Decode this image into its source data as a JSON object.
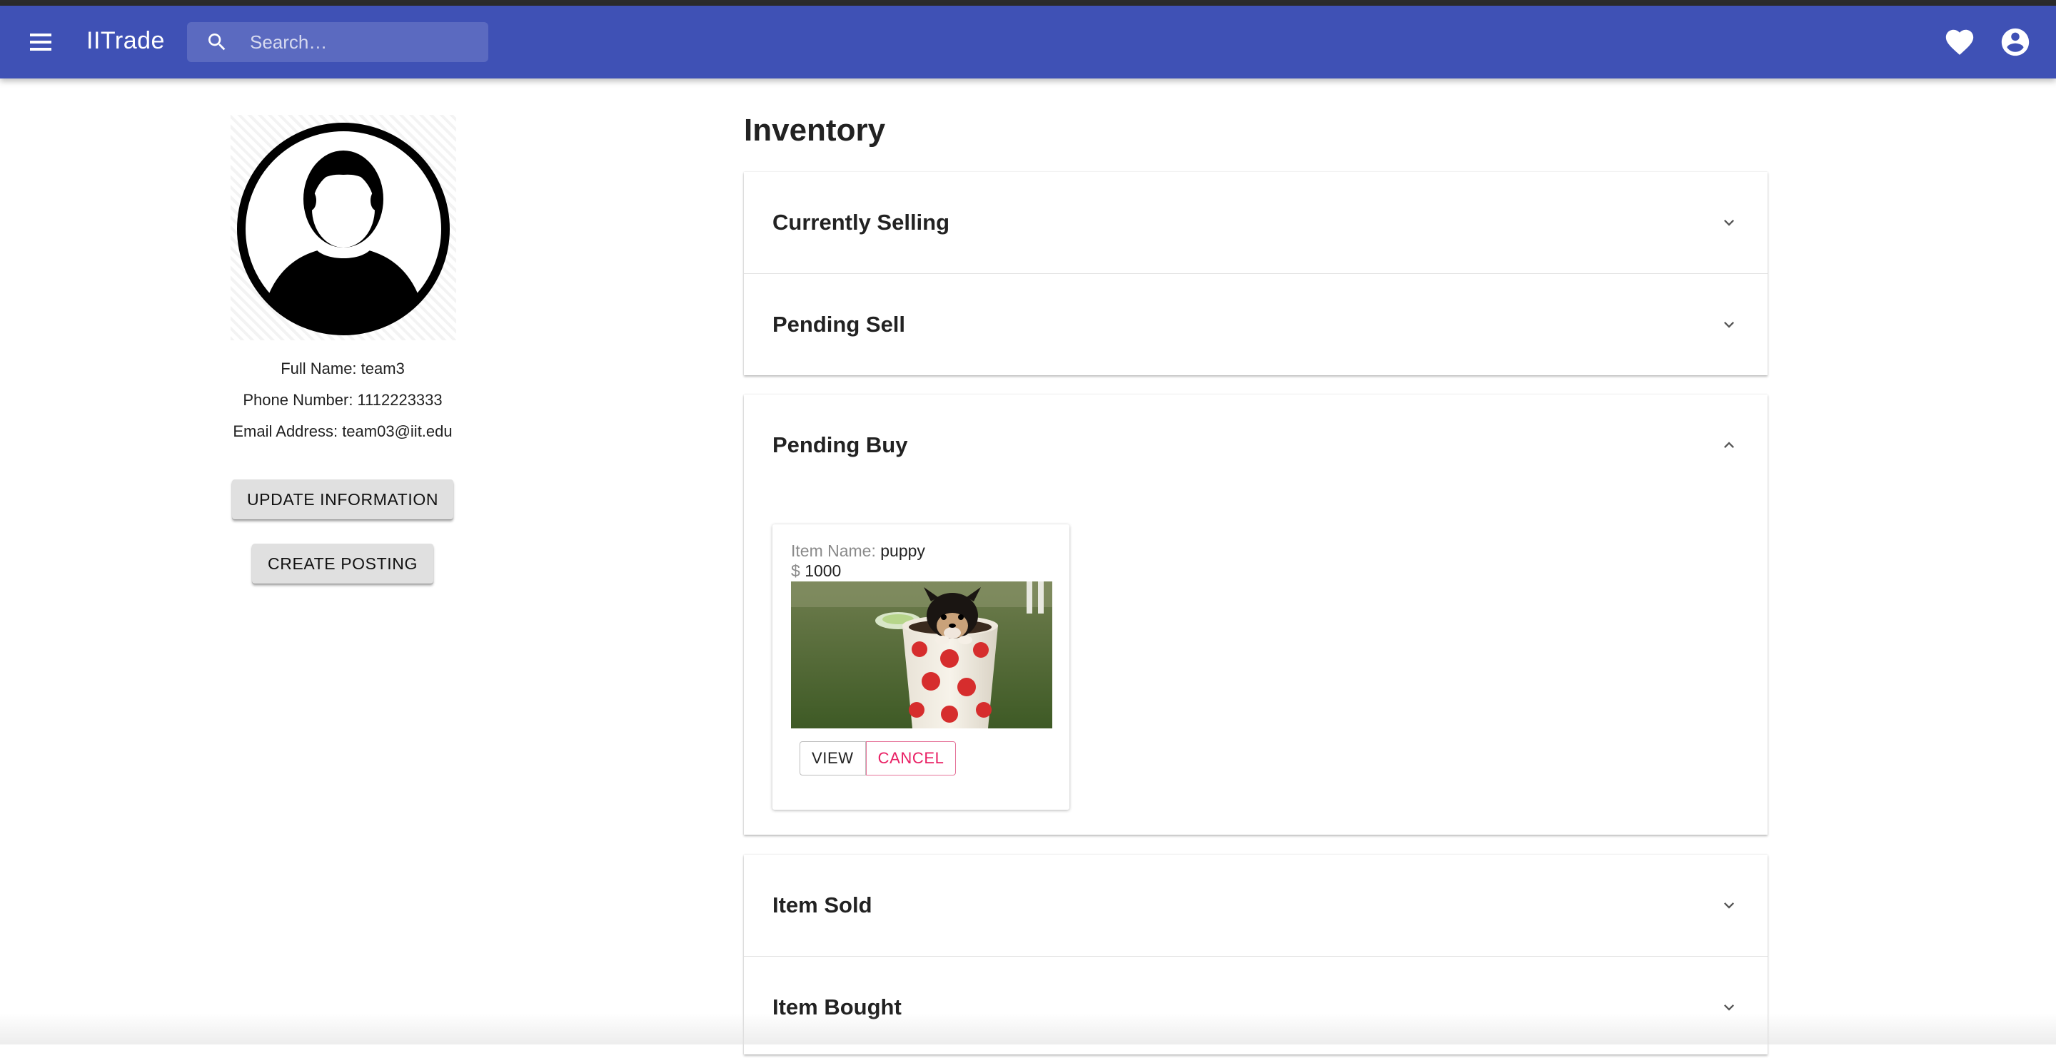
{
  "appbar": {
    "brand": "IITrade",
    "search_placeholder": "Search…",
    "accent_color": "#3f51b5",
    "icons": [
      "menu-icon",
      "search-icon",
      "heart-icon",
      "account-circle-icon"
    ]
  },
  "profile": {
    "full_name": "Full Name: team3",
    "phone": "Phone Number: 1112223333",
    "email": "Email Address: team03@iit.edu",
    "update_button": "UPDATE INFORMATION",
    "create_button": "CREATE POSTING"
  },
  "inventory": {
    "title": "Inventory",
    "sections": {
      "currently_selling": "Currently Selling",
      "pending_sell": "Pending Sell",
      "pending_buy": "Pending Buy",
      "item_sold": "Item Sold",
      "item_bought": "Item Bought"
    },
    "pending_buy_item": {
      "name_label": "Item Name:",
      "name": "puppy",
      "currency": "$",
      "price": "1000",
      "view_button": "VIEW",
      "cancel_button": "CANCEL",
      "cancel_color": "#e91e63"
    }
  }
}
